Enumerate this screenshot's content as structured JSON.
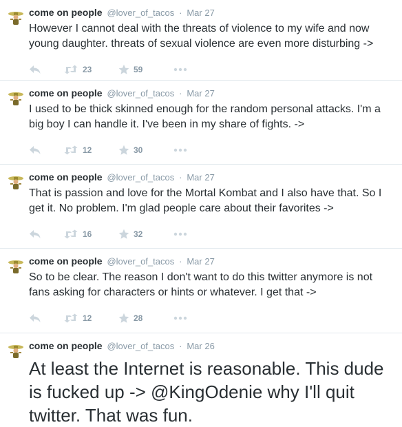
{
  "tweets": [
    {
      "name": "come on people",
      "handle": "@lover_of_tacos",
      "separator": "·",
      "time": "Mar 27",
      "text": "However I cannot deal with the threats of violence to my wife and now young daughter. threats of sexual violence are even more disturbing ->",
      "retweets": "23",
      "favorites": "59"
    },
    {
      "name": "come on people",
      "handle": "@lover_of_tacos",
      "separator": "·",
      "time": "Mar 27",
      "text": "I used to be thick skinned enough for the random personal attacks. I'm a big boy I can handle it. I've been in my share of fights. ->",
      "retweets": "12",
      "favorites": "30"
    },
    {
      "name": "come on people",
      "handle": "@lover_of_tacos",
      "separator": "·",
      "time": "Mar 27",
      "text": "That is passion and love for the Mortal Kombat and I also have that. So I get it. No problem. I'm glad people care about their favorites ->",
      "retweets": "16",
      "favorites": "32"
    },
    {
      "name": "come on people",
      "handle": "@lover_of_tacos",
      "separator": "·",
      "time": "Mar 27",
      "text": "So to be clear. The reason I don't want to do this twitter anymore is not fans asking for characters or hints or whatever. I get that ->",
      "retweets": "12",
      "favorites": "28"
    },
    {
      "name": "come on people",
      "handle": "@lover_of_tacos",
      "separator": "·",
      "time": "Mar 26",
      "text": "At least the Internet is reasonable. This dude is fucked up -> @KingOdenie why I'll quit twitter. That was fun."
    }
  ],
  "icons": {
    "avatar": "taco-avatar-icon",
    "reply": "reply-icon",
    "retweet": "retweet-icon",
    "favorite": "star-icon",
    "more": "more-icon"
  },
  "colors": {
    "text": "#292f33",
    "meta": "#8899a6",
    "icon": "#ccd6dd",
    "divider": "#e1e8ed"
  }
}
